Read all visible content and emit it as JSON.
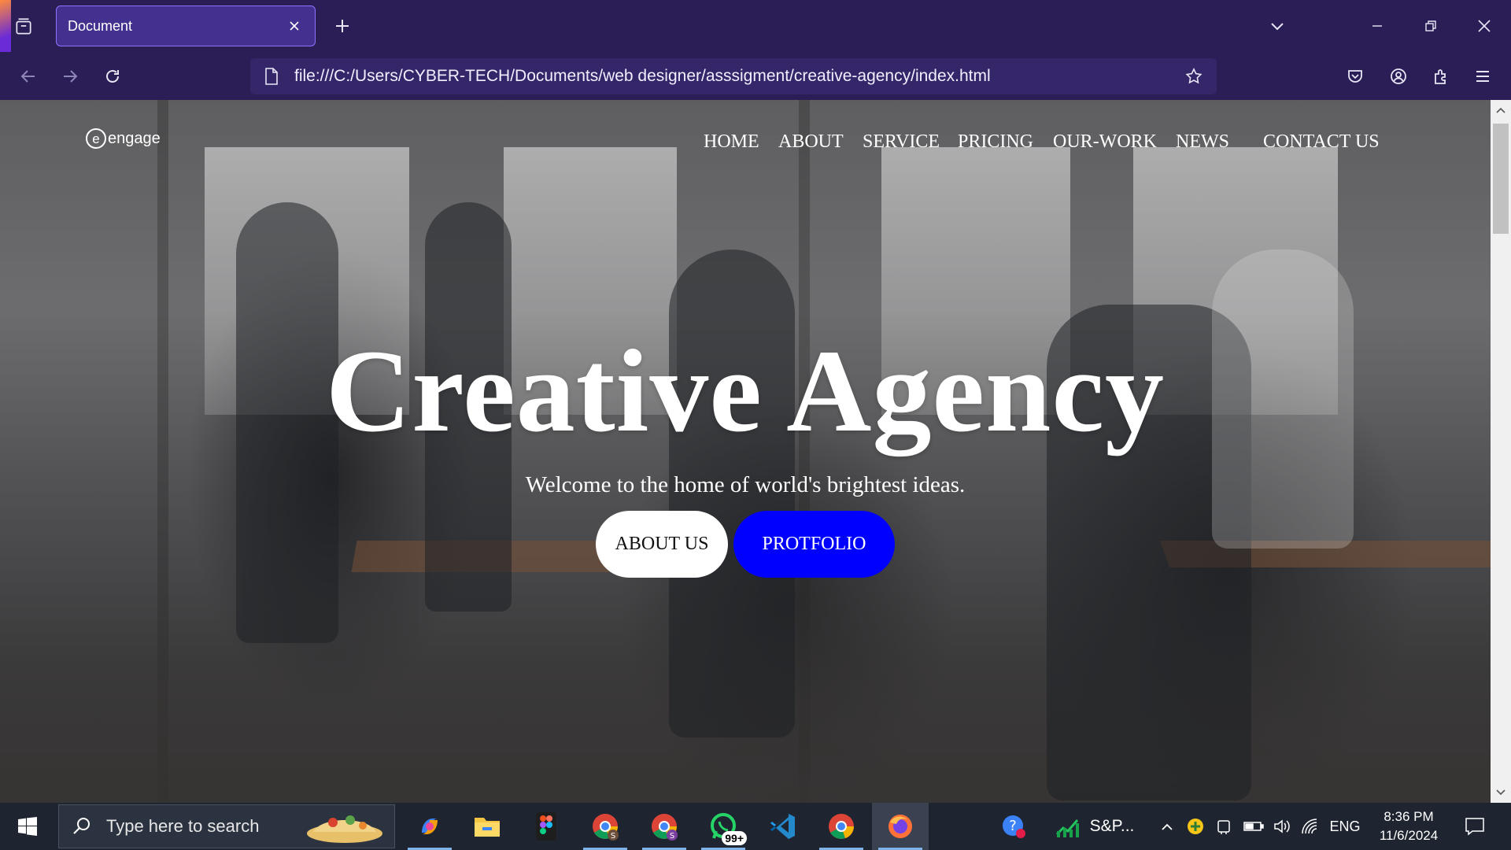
{
  "browser": {
    "tab_title": "Document",
    "url": "file:///C:/Users/CYBER-TECH/Documents/web designer/asssigment/creative-agency/index.html"
  },
  "site": {
    "logo_letter": "e",
    "logo_text": "engage",
    "nav": [
      "HOME",
      "ABOUT",
      "SERVICE",
      "PRICING",
      "OUR-WORK",
      "NEWS",
      "CONTACT US"
    ],
    "hero_title": "Creative Agency",
    "hero_subtitle": "Welcome to the home of world's brightest ideas.",
    "btn_about": "ABOUT US",
    "btn_portfolio": "PROTFOLIO",
    "colors": {
      "portfolio_button": "#0000ff",
      "about_button": "#ffffff"
    }
  },
  "taskbar": {
    "search_placeholder": "Type here to search",
    "whatsapp_badge": "99+",
    "stock_label": "S&P...",
    "language": "ENG",
    "time": "8:36 PM",
    "date": "11/6/2024"
  }
}
